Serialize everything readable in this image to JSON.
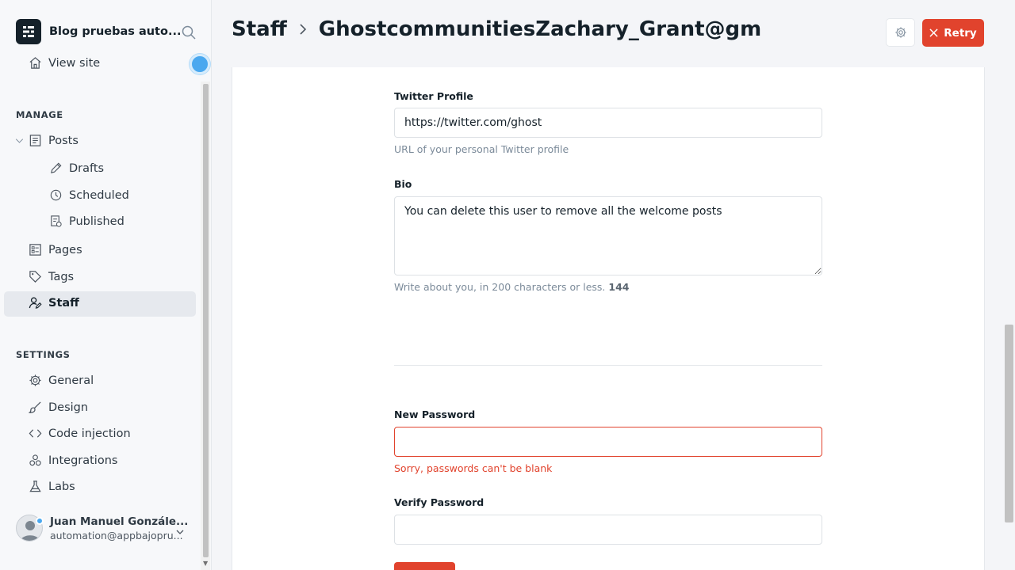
{
  "sidebar": {
    "blog_title": "Blog pruebas auto...",
    "view_site": "View site",
    "manage_label": "MANAGE",
    "settings_label": "SETTINGS",
    "posts": "Posts",
    "drafts": "Drafts",
    "scheduled": "Scheduled",
    "published": "Published",
    "pages": "Pages",
    "tags": "Tags",
    "staff": "Staff",
    "general": "General",
    "design": "Design",
    "code_injection": "Code injection",
    "integrations": "Integrations",
    "labs": "Labs",
    "user_name": "Juan Manuel Gonzále...",
    "user_email": "automation@appbajopru..."
  },
  "header": {
    "crumb_root": "Staff",
    "crumb_current": "GhostcommunitiesZachary_Grant@gm",
    "retry": "Retry"
  },
  "form": {
    "twitter_label": "Twitter Profile",
    "twitter_value": "https://twitter.com/ghost",
    "twitter_hint": "URL of your personal Twitter profile",
    "bio_label": "Bio",
    "bio_value": "You can delete this user to remove all the welcome posts",
    "bio_hint": "Write about you, in 200 characters or less.",
    "bio_count": "144",
    "new_password_label": "New Password",
    "new_password_value": "",
    "new_password_error": "Sorry, passwords can't be blank",
    "verify_password_label": "Verify Password",
    "verify_password_value": ""
  },
  "colors": {
    "accent_red": "#e1432d",
    "spinner_blue": "#4aa8ef",
    "active_nav_bg": "#e6e9ee"
  },
  "icons": [
    "search-icon",
    "home-icon",
    "posts-icon",
    "pencil-icon",
    "clock-icon",
    "published-icon",
    "pages-icon",
    "tag-icon",
    "staff-icon",
    "gear-icon",
    "brush-icon",
    "code-icon",
    "integrations-icon",
    "flask-icon",
    "chevron-down-icon",
    "chevron-right-icon",
    "close-icon"
  ]
}
